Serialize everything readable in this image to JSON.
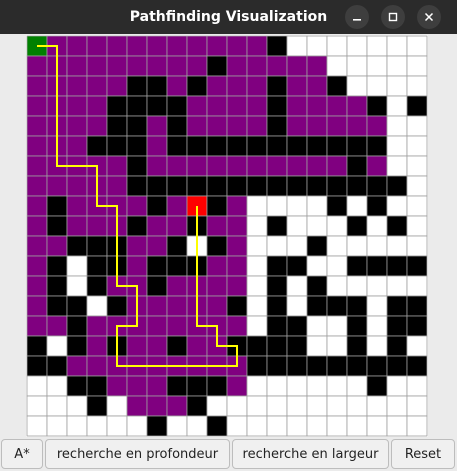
{
  "window": {
    "title": "Pathfinding Visualization"
  },
  "controls": {
    "minimize_icon": "minimize-icon",
    "maximize_icon": "maximize-icon",
    "close_icon": "close-icon"
  },
  "buttons": {
    "astar": "A*",
    "dfs": "recherche en profondeur",
    "bfs": "recherche en largeur",
    "reset": "Reset"
  },
  "colors": {
    "visited": "#800080",
    "wall": "#000000",
    "empty": "#ffffff",
    "start": "#008000",
    "end": "#ff0000",
    "path": "#ffff00",
    "gridline": "#9e9e9e"
  },
  "grid": {
    "rows": 20,
    "cols": 20,
    "cells": [
      "SVVVVVVVVVVFWEEEEEEE",
      "VVVVVVVVVWVVVVVEEEEE",
      "VVVVVWWVWVVVWVVWEEEE",
      "VVVVWWWWVVVVWVVVVWEW",
      "VVVVWWVWVVVVWVVVVVEE",
      "VVVWWWVWWWWWWWWWWWEE",
      "VVVVVWVVVVVVVVVVWVEE",
      "VVVVVWWWWWWWWWWWWWWE",
      "VWVVVVWVGWVEEEEWEWEE",
      "VWVVVWVVWVVEWEEEWEWE",
      "VVWWWVVWEWVEEEWEEEEE",
      "VWEWWVWWWVVEWWEEWWWW",
      "VWEWVVWVVVVEWEWEEEEE",
      "VWWEWVVVVVWEWEWWWEWW",
      "VVWVVVVVVVVEWWEEWEWW",
      "WEWVWVVWVVWWWWEEWEWE",
      "WWVVVVVVVVVWWWWWWWWW",
      "EEWWVVVWWWVEEEEEEWEE",
      "EEEWEVVVWEEEEEEEEEEE",
      "EEEEEEWEEWEEEEEEEEEE"
    ],
    "path": [
      [
        0,
        0
      ],
      [
        1,
        0
      ],
      [
        1,
        6
      ],
      [
        3,
        6
      ],
      [
        3,
        8
      ],
      [
        4,
        8
      ],
      [
        4,
        12
      ],
      [
        5,
        12
      ],
      [
        5,
        14
      ],
      [
        4,
        14
      ],
      [
        4,
        16
      ],
      [
        10,
        16
      ],
      [
        10,
        15
      ],
      [
        9,
        15
      ],
      [
        9,
        14
      ],
      [
        8,
        14
      ],
      [
        8,
        8
      ]
    ]
  }
}
